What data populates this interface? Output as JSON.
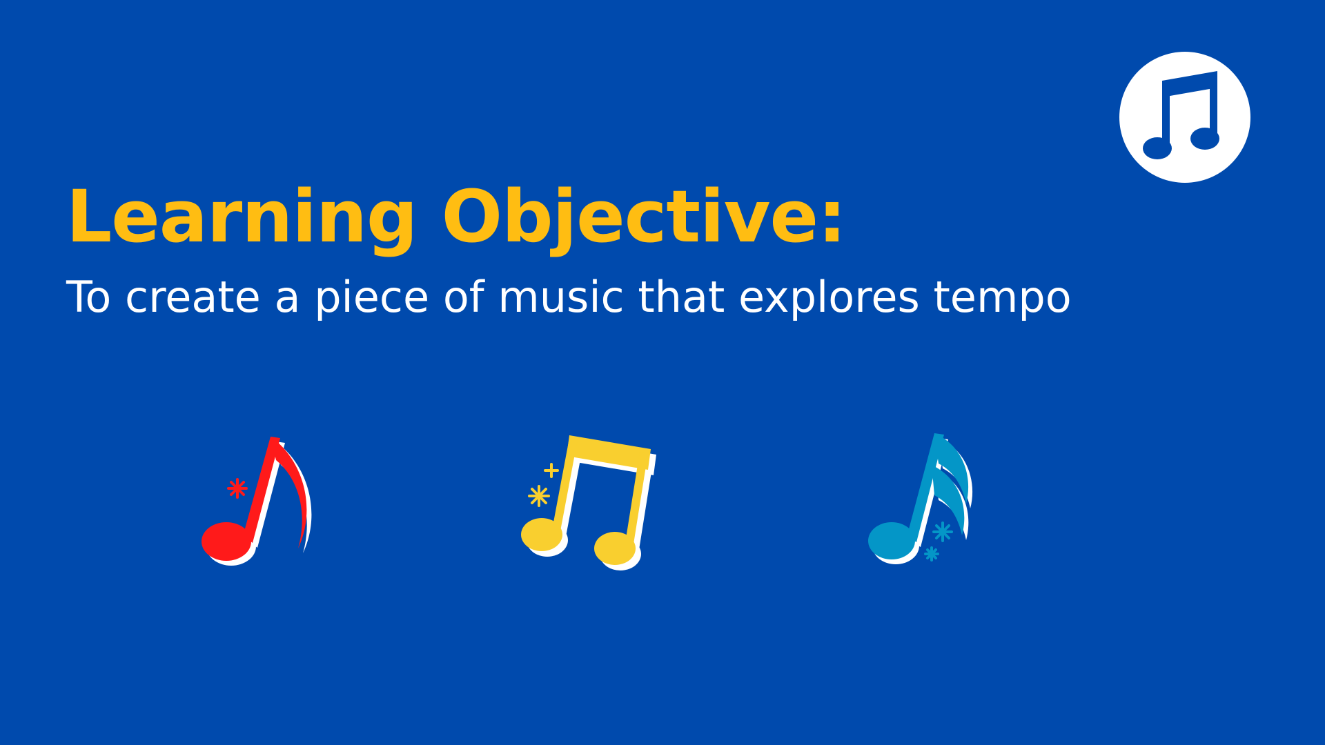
{
  "slide": {
    "title": "Learning Objective:",
    "subtitle": "To create a piece of music that explores tempo"
  },
  "colors": {
    "background": "#004aad",
    "title": "#ffbd12",
    "subtitle": "#ffffff",
    "badge_bg": "#ffffff",
    "badge_icon": "#004aad",
    "note_red": "#ff1a1a",
    "note_yellow": "#f9cf2f",
    "note_blue": "#0496c7",
    "note_shadow": "#ffffff"
  },
  "icons": {
    "badge": "beamed-eighth-notes-icon",
    "notes": [
      "eighth-note-icon",
      "beamed-eighth-notes-icon",
      "sixteenth-note-icon"
    ]
  }
}
